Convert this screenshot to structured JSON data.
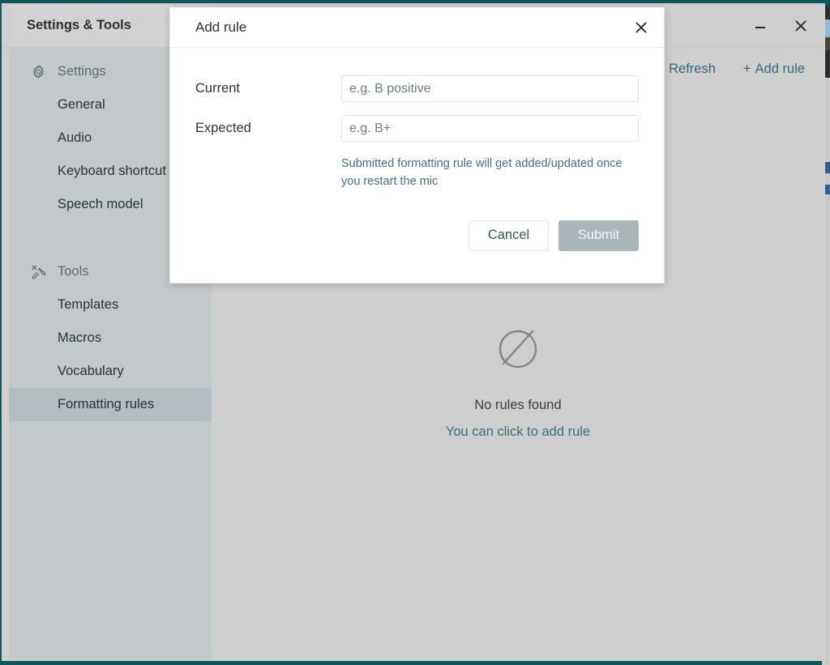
{
  "window": {
    "title": "Settings & Tools",
    "minimize_label": "Minimize",
    "close_label": "Close"
  },
  "sidebar": {
    "groups": [
      {
        "label": "Settings",
        "icon": "gear-icon",
        "items": [
          {
            "label": "General",
            "active": false
          },
          {
            "label": "Audio",
            "active": false
          },
          {
            "label": "Keyboard shortcut",
            "active": false
          },
          {
            "label": "Speech model",
            "active": false
          }
        ]
      },
      {
        "label": "Tools",
        "icon": "tools-icon",
        "items": [
          {
            "label": "Templates",
            "active": false
          },
          {
            "label": "Macros",
            "active": false
          },
          {
            "label": "Vocabulary",
            "active": false
          },
          {
            "label": "Formatting rules",
            "active": true
          }
        ]
      }
    ]
  },
  "main": {
    "toolbar": {
      "refresh_label": "Refresh",
      "add_rule_label": "Add rule",
      "add_rule_plus": "+"
    },
    "empty_state": {
      "icon": "empty-set-icon",
      "title": "No rules found",
      "action_label": "You can click to add rule"
    }
  },
  "dialog": {
    "title": "Add rule",
    "close_label": "×",
    "fields": [
      {
        "label": "Current",
        "value": "",
        "placeholder": "e.g. B positive"
      },
      {
        "label": "Expected",
        "value": "",
        "placeholder": "e.g. B+"
      }
    ],
    "hint": "Submitted formatting rule will get added/updated once you restart the mic",
    "cancel_label": "Cancel",
    "submit_label": "Submit"
  },
  "colors": {
    "accent_teal": "#0d5659",
    "link": "#336d7f",
    "sidebar_bg": "#c3c9ca",
    "sidebar_active": "#b3bcc0",
    "panel_bg": "#cecece",
    "submit_bg": "#a9b5b8"
  }
}
